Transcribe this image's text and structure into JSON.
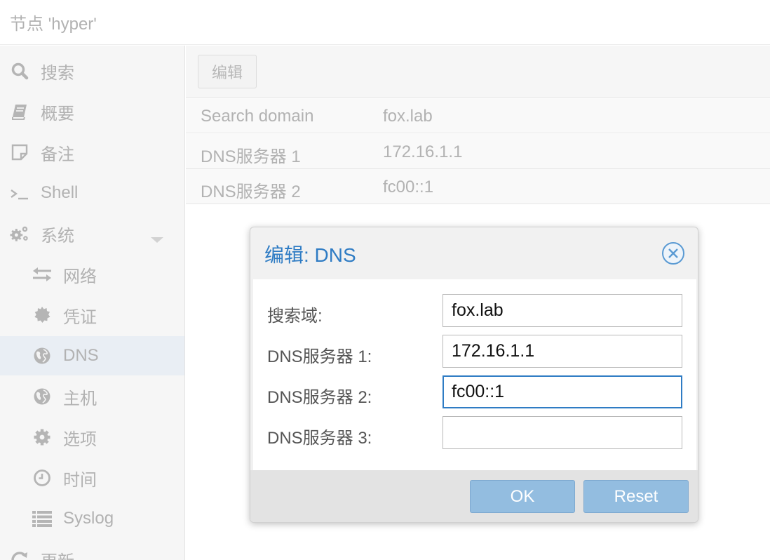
{
  "header": {
    "title": "节点 'hyper'"
  },
  "sidebar": {
    "items": [
      {
        "label": "搜索",
        "icon": "search-icon",
        "level": 1
      },
      {
        "label": "概要",
        "icon": "book-icon",
        "level": 1
      },
      {
        "label": "备注",
        "icon": "note-icon",
        "level": 1
      },
      {
        "label": "Shell",
        "icon": "terminal-icon",
        "level": 1
      },
      {
        "label": "系统",
        "icon": "gears-icon",
        "level": 1,
        "expanded": true
      },
      {
        "label": "网络",
        "icon": "exchange-icon",
        "level": 2
      },
      {
        "label": "凭证",
        "icon": "certificate-icon",
        "level": 2
      },
      {
        "label": "DNS",
        "icon": "globe-icon",
        "level": 2,
        "selected": true
      },
      {
        "label": "主机",
        "icon": "globe-icon",
        "level": 2
      },
      {
        "label": "选项",
        "icon": "gear-icon",
        "level": 2
      },
      {
        "label": "时间",
        "icon": "clock-icon",
        "level": 2
      },
      {
        "label": "Syslog",
        "icon": "list-icon",
        "level": 2
      },
      {
        "label": "更新",
        "icon": "refresh-icon",
        "level": 1
      }
    ]
  },
  "toolbar": {
    "edit_label": "编辑"
  },
  "dns_grid": {
    "rows": [
      {
        "key": "Search domain",
        "value": "fox.lab"
      },
      {
        "key": "DNS服务器 1",
        "value": "172.16.1.1"
      },
      {
        "key": "DNS服务器 2",
        "value": "fc00::1"
      }
    ]
  },
  "dialog": {
    "title": "编辑: DNS",
    "fields": [
      {
        "label": "搜索域:",
        "value": "fox.lab"
      },
      {
        "label": "DNS服务器 1:",
        "value": "172.16.1.1"
      },
      {
        "label": "DNS服务器 2:",
        "value": "fc00::1",
        "focused": true
      },
      {
        "label": "DNS服务器 3:",
        "value": ""
      }
    ],
    "ok_label": "OK",
    "reset_label": "Reset"
  },
  "colors": {
    "accent": "#2f7cc4",
    "button_disabled": "#93bde0",
    "selected_row": "#e9eef4"
  }
}
